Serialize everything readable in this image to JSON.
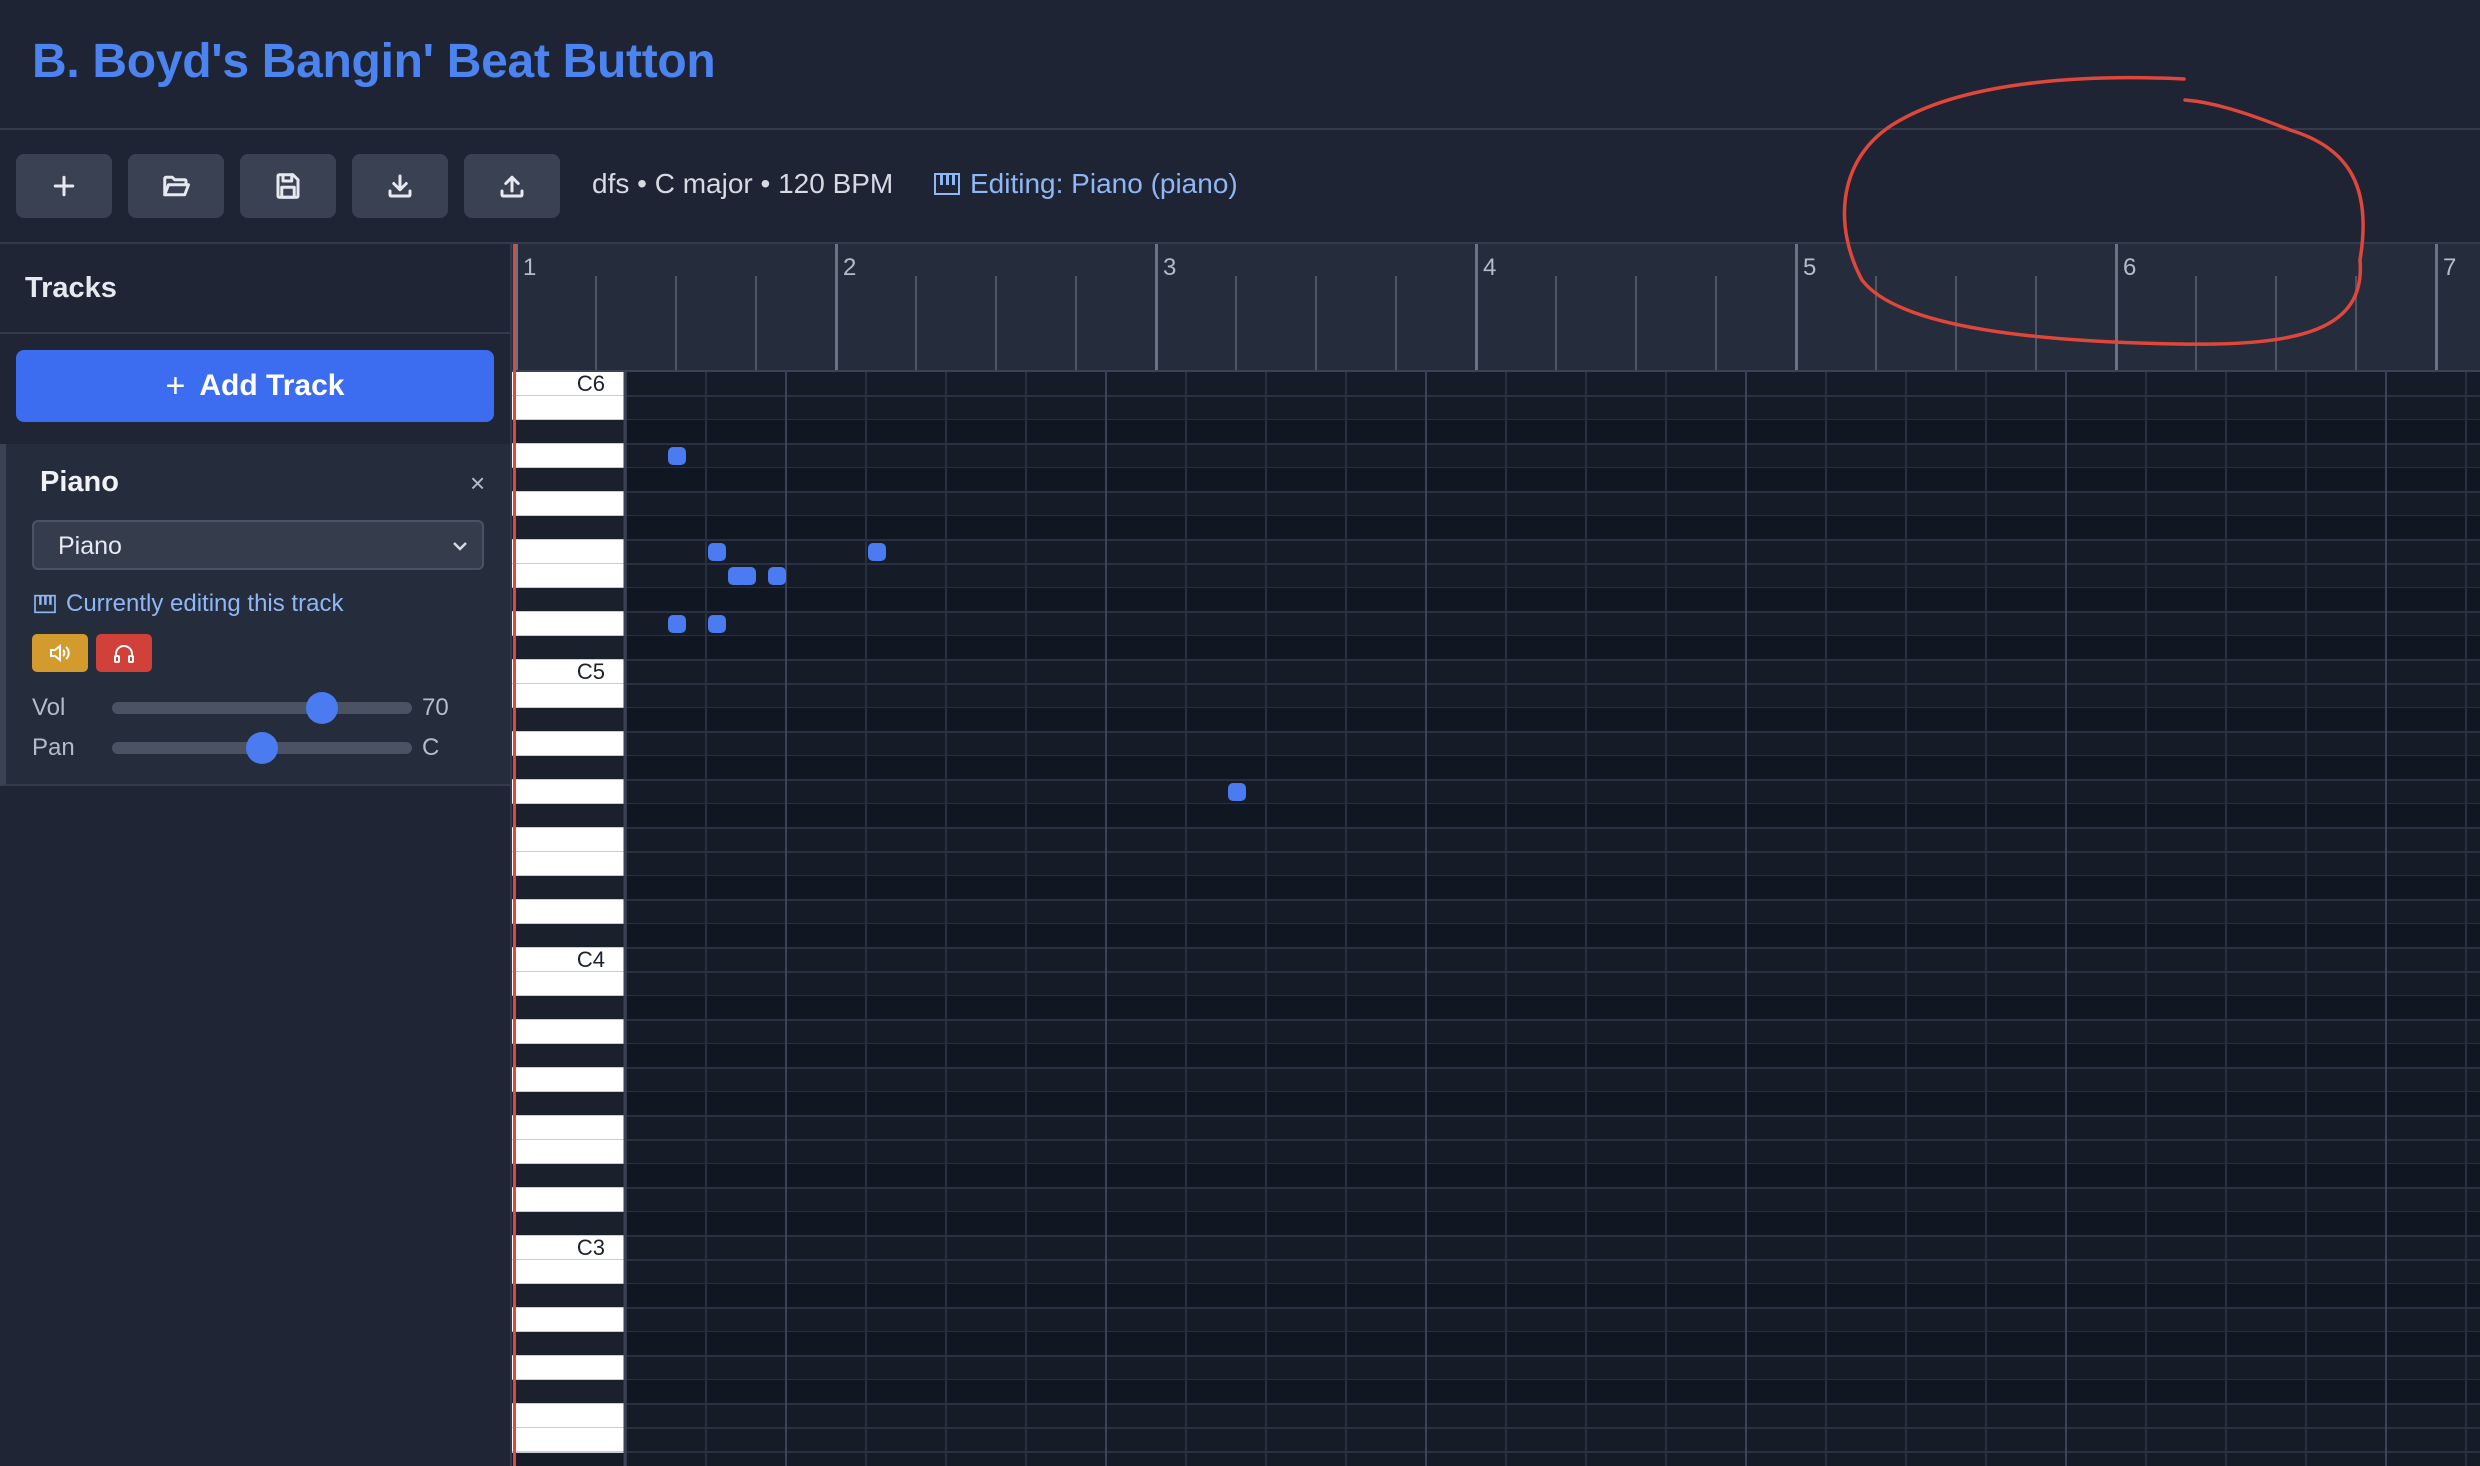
{
  "app": {
    "title": "B. Boyd's Bangin' Beat Button"
  },
  "toolbar": {
    "buttons": [
      {
        "name": "new-project-button",
        "icon": "plus-icon"
      },
      {
        "name": "open-project-button",
        "icon": "folder-open-icon"
      },
      {
        "name": "save-project-button",
        "icon": "save-icon"
      },
      {
        "name": "download-button",
        "icon": "download-icon"
      },
      {
        "name": "upload-button",
        "icon": "upload-icon"
      }
    ],
    "song_info": "dfs • C major • 120 BPM",
    "editing_label": "Editing: Piano (piano)"
  },
  "sidebar": {
    "title": "Tracks",
    "add_track_label": "Add Track",
    "tracks": [
      {
        "name": "Piano",
        "remove_label": "×",
        "instrument": "Piano",
        "editing_note": "Currently editing this track",
        "vol_label": "Vol",
        "vol_value": "70",
        "vol_level": 0.7,
        "pan_label": "Pan",
        "pan_value": "C",
        "pan_level": 0.5,
        "mute_color": "#d39a2e",
        "solo_color": "#d2403a"
      }
    ]
  },
  "timeline": {
    "bar_numbers": [
      "1",
      "2",
      "3",
      "4",
      "5",
      "6",
      "7"
    ],
    "beats_per_bar": 4
  },
  "piano_roll": {
    "octave_labels": [
      "C6",
      "C5",
      "C4",
      "C3"
    ],
    "note_color": "#4b7bf0",
    "notes": [
      {
        "pitch": "A5",
        "beat": 1.5
      },
      {
        "pitch": "F5",
        "beat": 2.0
      },
      {
        "pitch": "F5",
        "beat": 4.0
      },
      {
        "pitch": "E5",
        "beat": 2.25
      },
      {
        "pitch": "E5",
        "beat": 2.375
      },
      {
        "pitch": "E5",
        "beat": 2.75
      },
      {
        "pitch": "D5",
        "beat": 1.5
      },
      {
        "pitch": "D5",
        "beat": 2.0
      },
      {
        "pitch": "G4",
        "beat": 8.5
      }
    ]
  },
  "annotation": {
    "color": "#e0463a"
  },
  "colors": {
    "accent": "#4b83f0",
    "playhead": "#e2473f",
    "background": "#1e2433"
  }
}
